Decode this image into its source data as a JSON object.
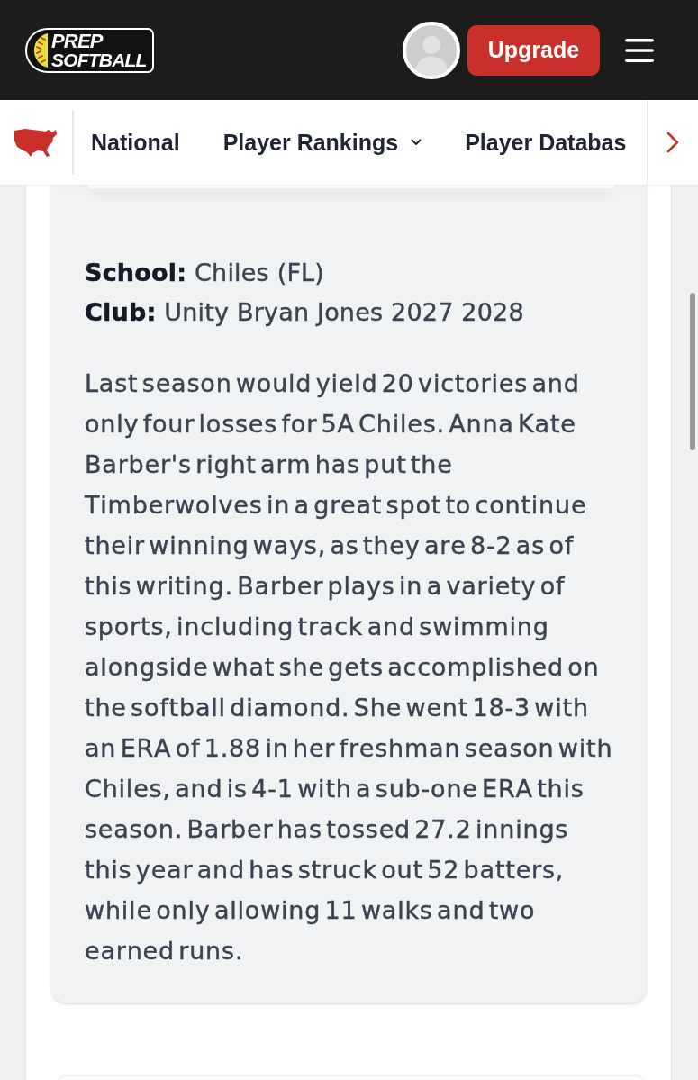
{
  "header": {
    "logo": {
      "top": "PREP",
      "bottom": "SOFTBALL"
    },
    "upgrade_button": "Upgrade"
  },
  "nav": {
    "items": [
      {
        "label": "National",
        "dropdown": false
      },
      {
        "label": "Player Rankings",
        "dropdown": true
      },
      {
        "label": "Player Databas",
        "dropdown": false
      }
    ]
  },
  "profile": {
    "fields": [
      "**School:** Chiles (FL)",
      "**Club:** Unity Bryan Jones 2027 2028"
    ],
    "paragraph": "Last season would yield 20 victories and only four losses for 5A Chiles. Anna Kate Barber's right arm has put the Timberwolves in a great spot to continue their winning ways, as they are 8-2 as of this writing. Barber plays in a variety of sports, including track and swimming alongside what she gets accomplished on the softball diamond. She went 18-3 with an ERA of 1.88 in her freshman season with Chiles, and is 4-1 with a sub-one ERA this season. Barber has tossed 27.2 innings this year and has struck out 52 batters, while only allowing 11 walks and two earned runs."
  }
}
